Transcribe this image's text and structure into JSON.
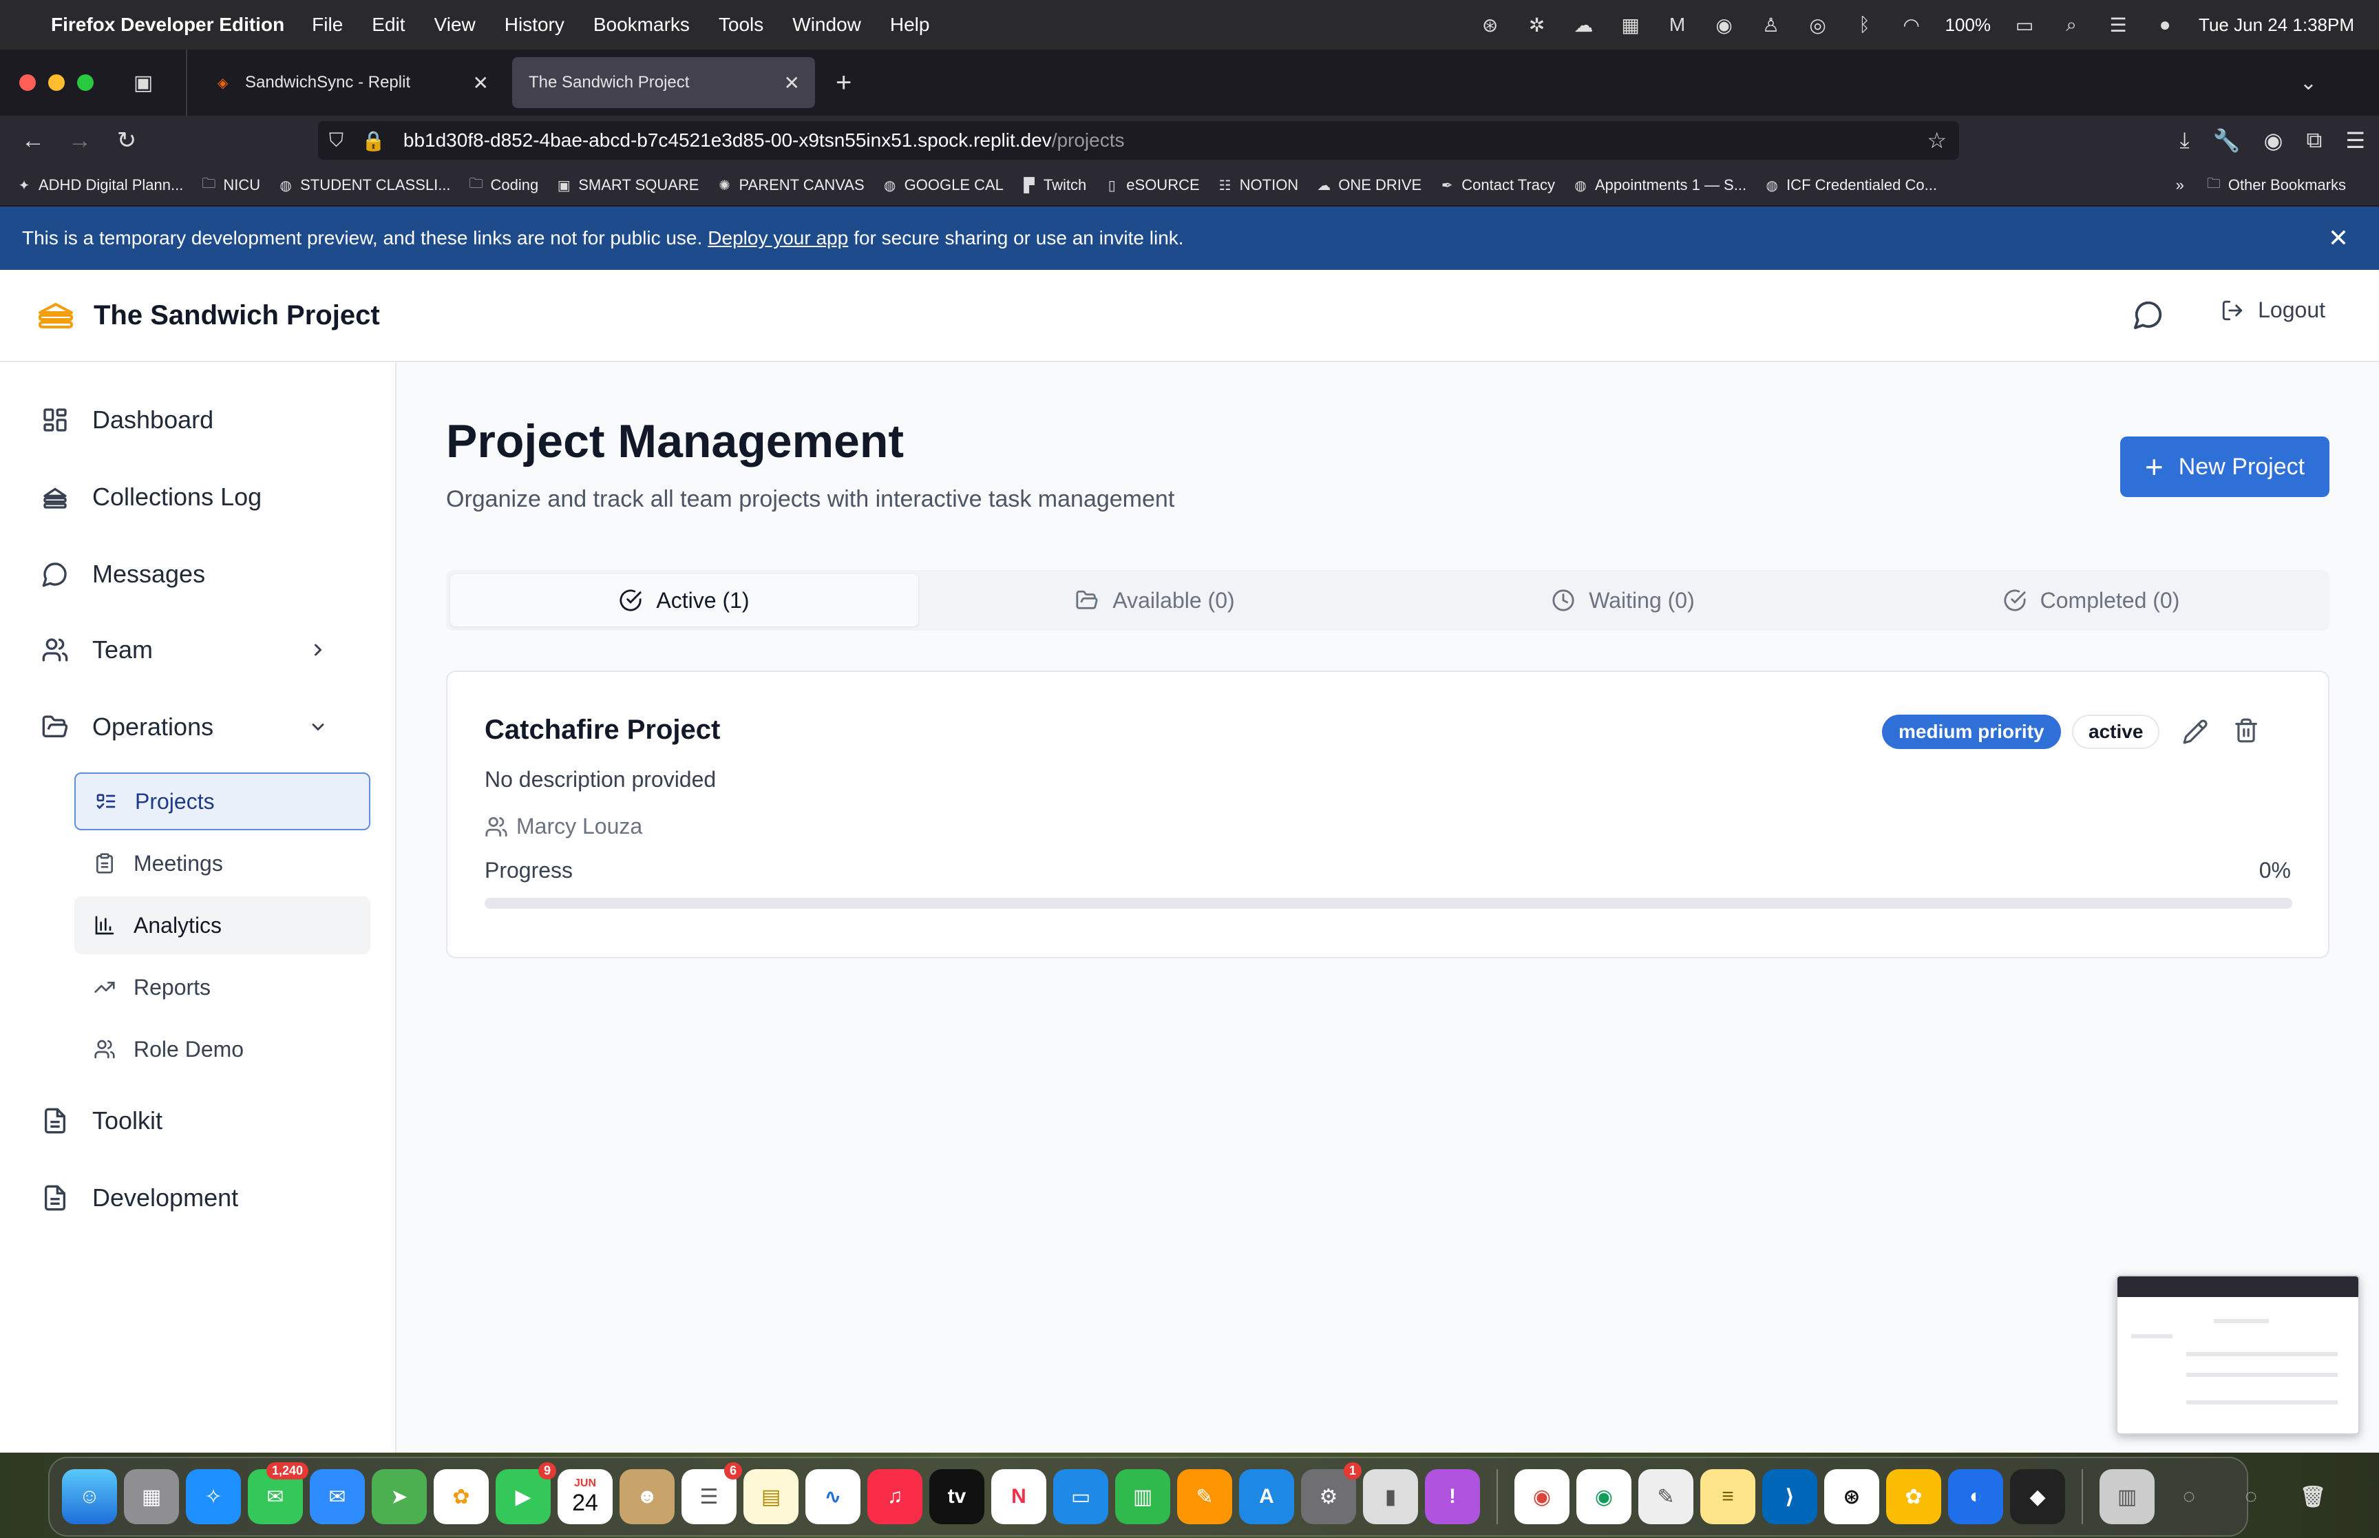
{
  "menubar": {
    "app_name": "Firefox Developer Edition",
    "menus": [
      "File",
      "Edit",
      "View",
      "History",
      "Bookmarks",
      "Tools",
      "Window",
      "Help"
    ],
    "battery": "100%",
    "clock": "Tue Jun 24  1:38PM"
  },
  "browser": {
    "tabs": [
      {
        "title": "SandwichSync - Replit",
        "active": false
      },
      {
        "title": "The Sandwich Project",
        "active": true
      }
    ],
    "url_host": "bb1d30f8-d852-4bae-abcd-b7c4521e3d85-00-x9tsn55inx51.spock.replit.dev",
    "url_path": "/projects",
    "bookmarks": [
      {
        "label": "ADHD Digital Plann...",
        "icon": "app-icon"
      },
      {
        "label": "NICU",
        "icon": "folder-icon"
      },
      {
        "label": "STUDENT CLASSLI...",
        "icon": "globe-icon"
      },
      {
        "label": "Coding",
        "icon": "folder-icon"
      },
      {
        "label": "SMART SQUARE",
        "icon": "square-icon"
      },
      {
        "label": "PARENT CANVAS",
        "icon": "canvas-icon"
      },
      {
        "label": "GOOGLE CAL",
        "icon": "globe-icon"
      },
      {
        "label": "Twitch",
        "icon": "twitch-icon"
      },
      {
        "label": "eSOURCE",
        "icon": "doc-icon"
      },
      {
        "label": "NOTION",
        "icon": "list-icon"
      },
      {
        "label": "ONE DRIVE",
        "icon": "cloud-icon"
      },
      {
        "label": "Contact Tracy",
        "icon": "feather-icon"
      },
      {
        "label": "Appointments 1 — S...",
        "icon": "globe-icon"
      },
      {
        "label": "ICF Credentialed Co...",
        "icon": "globe-icon"
      }
    ],
    "other_bookmarks": "Other Bookmarks"
  },
  "banner": {
    "text_before": "This is a temporary development preview, and these links are not for public use.",
    "link": "Deploy your app",
    "text_after": "for secure sharing or use an invite link."
  },
  "header": {
    "title": "The Sandwich Project",
    "logout": "Logout"
  },
  "sidebar": {
    "items": [
      {
        "label": "Dashboard"
      },
      {
        "label": "Collections Log"
      },
      {
        "label": "Messages"
      },
      {
        "label": "Team"
      },
      {
        "label": "Operations"
      }
    ],
    "sub_items": [
      {
        "label": "Projects"
      },
      {
        "label": "Meetings"
      },
      {
        "label": "Analytics"
      },
      {
        "label": "Reports"
      },
      {
        "label": "Role Demo"
      }
    ],
    "bottom_items": [
      {
        "label": "Toolkit"
      },
      {
        "label": "Development"
      }
    ]
  },
  "main": {
    "title": "Project Management",
    "subtitle": "Organize and track all team projects with interactive task management",
    "new_button": "New Project",
    "tabs": [
      {
        "label": "Active (1)"
      },
      {
        "label": "Available (0)"
      },
      {
        "label": "Waiting (0)"
      },
      {
        "label": "Completed (0)"
      }
    ],
    "project": {
      "name": "Catchafire Project",
      "description": "No description provided",
      "owner": "Marcy Louza",
      "priority": "medium priority",
      "status": "active",
      "progress_label": "Progress",
      "progress_text": "0%",
      "progress_value": 0
    }
  },
  "dock": {
    "badges": {
      "messages": "1,240",
      "facetime": "9",
      "reminders": "6",
      "settings": "1"
    },
    "calendar_month": "JUN",
    "calendar_day": "24"
  },
  "colors": {
    "primary": "#2f6fd8",
    "banner": "#1e4b8c",
    "logo": "#f59e0b"
  }
}
